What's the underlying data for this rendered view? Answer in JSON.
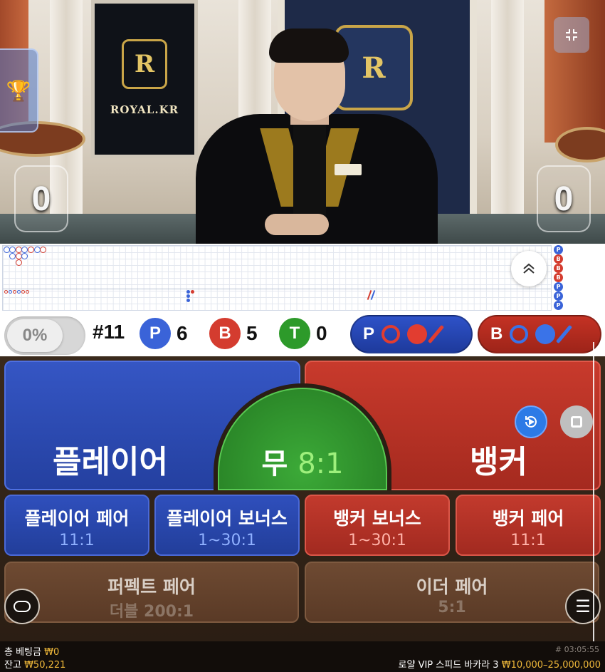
{
  "video": {
    "brand_left": "ROYAL.KR",
    "crest_letter": "R",
    "player_score": "0",
    "banker_score": "0"
  },
  "roadmap": {
    "big_road": [
      {
        "col": 0,
        "row": 0,
        "color": "#3a63d8"
      },
      {
        "col": 1,
        "row": 0,
        "color": "#3a63d8"
      },
      {
        "col": 1,
        "row": 1,
        "color": "#3a63d8"
      },
      {
        "col": 2,
        "row": 0,
        "color": "#d43c2f"
      },
      {
        "col": 2,
        "row": 1,
        "color": "#d43c2f"
      },
      {
        "col": 2,
        "row": 2,
        "color": "#d43c2f"
      },
      {
        "col": 3,
        "row": 0,
        "color": "#3a63d8"
      },
      {
        "col": 3,
        "row": 1,
        "color": "#3a63d8"
      },
      {
        "col": 4,
        "row": 0,
        "color": "#d43c2f"
      },
      {
        "col": 5,
        "row": 0,
        "color": "#3a63d8"
      },
      {
        "col": 6,
        "row": 0,
        "color": "#d43c2f"
      }
    ],
    "bead_column": [
      "P",
      "B",
      "B",
      "B",
      "P",
      "P",
      "P"
    ]
  },
  "stats": {
    "percent_toggle": "0%",
    "round": "#11",
    "player_letter": "P",
    "player_count": "6",
    "banker_letter": "B",
    "banker_count": "5",
    "tie_letter": "T",
    "tie_count": "0",
    "predict_player_letter": "P",
    "predict_banker_letter": "B"
  },
  "bets": {
    "player_label": "플레이어",
    "banker_label": "뱅커",
    "tie_label": "무",
    "tie_odds": "8:1",
    "player_pair_name": "플레이어 페어",
    "player_pair_odds": "11:1",
    "player_bonus_name": "플레이어 보너스",
    "player_bonus_odds": "1~30:1",
    "banker_bonus_name": "뱅커 보너스",
    "banker_bonus_odds": "1~30:1",
    "banker_pair_name": "뱅커 페어",
    "banker_pair_odds": "11:1",
    "perfect_pair_name": "퍼펙트 페어",
    "perfect_pair_odds": "더블 200:1",
    "either_pair_name": "이더 페어",
    "either_pair_odds": "5:1"
  },
  "footer": {
    "total_bet_label": "총 베팅금",
    "total_bet_value": "₩0",
    "balance_label": "잔고",
    "balance_value": "₩50,221",
    "game_id": "# 03:05:55",
    "table_name": "로얄 VIP 스피드 바카라 3",
    "limits": "₩10,000–25,000,000"
  },
  "colors": {
    "player_blue": "#3a63d8",
    "banker_red": "#d43c2f",
    "tie_green": "#2d9a2a",
    "gold": "#f0b93a"
  }
}
